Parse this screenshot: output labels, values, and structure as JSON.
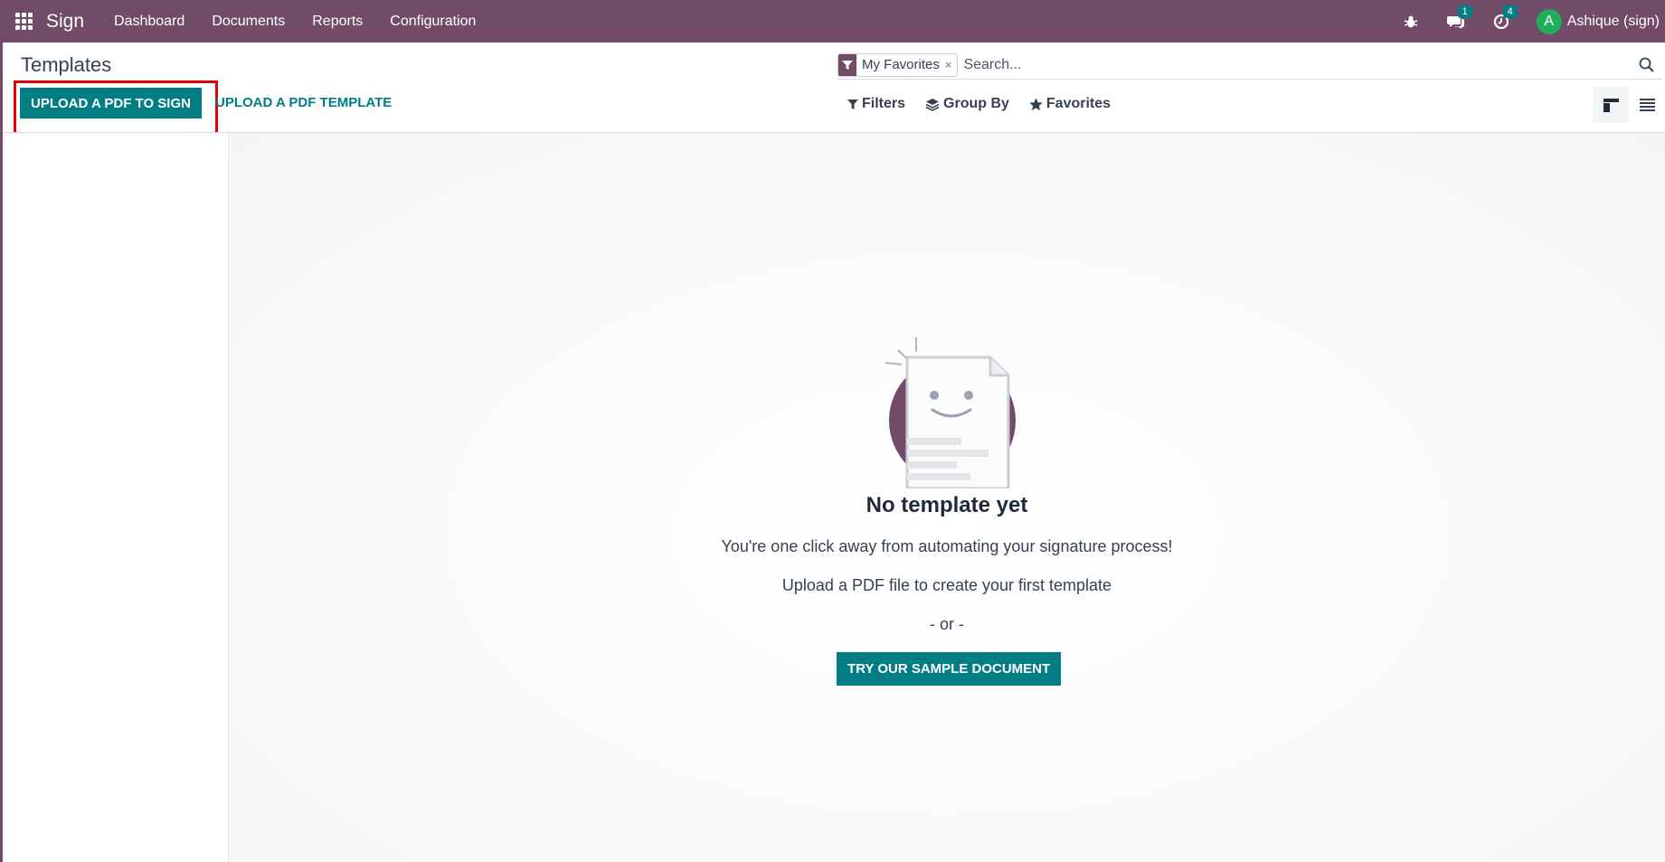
{
  "navbar": {
    "brand": "Sign",
    "menu": [
      {
        "label": "Dashboard"
      },
      {
        "label": "Documents"
      },
      {
        "label": "Reports"
      },
      {
        "label": "Configuration"
      }
    ],
    "messages_count": "1",
    "activities_count": "4",
    "avatar_letter": "A",
    "user_name": "Ashique (sign)"
  },
  "control_panel": {
    "title": "Templates",
    "upload_sign_label": "UPLOAD A PDF TO SIGN",
    "upload_template_label": "UPLOAD A PDF TEMPLATE",
    "search": {
      "facet_label": "My Favorites",
      "facet_remove": "×",
      "placeholder": "Search..."
    },
    "filters_label": "Filters",
    "groupby_label": "Group By",
    "favorites_label": "Favorites"
  },
  "empty_state": {
    "title": "No template yet",
    "line1": "You're one click away from automating your signature process!",
    "line2": "Upload a PDF file to create your first template",
    "line3": "- or -",
    "sample_button": "TRY OUR SAMPLE DOCUMENT"
  },
  "colors": {
    "brand": "#714b67",
    "primary": "#017e84",
    "highlight": "#e30000"
  }
}
